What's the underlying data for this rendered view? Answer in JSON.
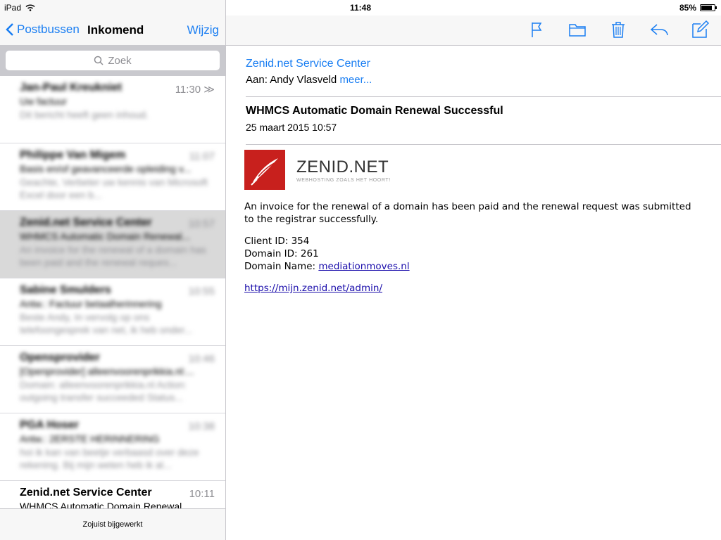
{
  "status": {
    "device": "iPad",
    "time": "11:48",
    "battery": "85%",
    "battery_level": 0.85
  },
  "nav": {
    "back_label": "Postbussen",
    "title": "Inkomend",
    "edit_label": "Wijzig"
  },
  "search": {
    "placeholder": "Zoek"
  },
  "mail_list": [
    {
      "sender": "Jan-Paul Kreukniet",
      "time": "11:30",
      "subject": "Uw factuur",
      "preview": "Dit bericht heeft geen inhoud."
    },
    {
      "sender": "Philippe Van Migem",
      "time": "11:07",
      "subject": "Basis en/of geavanceerde opleiding v...",
      "preview": "Geachte, Verbeter uw kennis van Microsoft Excel door een b..."
    },
    {
      "sender": "Zenid.net Service Center",
      "time": "10:57",
      "subject": "WHMCS Automatic Domain Renewal...",
      "preview": "An invoice for the renewal of a domain has been paid and the renewal reques..."
    },
    {
      "sender": "Sabine Smulders",
      "time": "10:55",
      "subject": "Antw.: Factuur betaalherinnering",
      "preview": "Beste Andy, In vervolg op ons telefoongesprek van net, ik heb onder..."
    },
    {
      "sender": "Opensprovider",
      "time": "10:46",
      "subject": "[Openprovider] alleenvoorenprikkia.nl:...",
      "preview": "Domain: alleenvoorenprikkia.nl Action: outgoing transfer succeeded Status..."
    },
    {
      "sender": "PGA Hoser",
      "time": "10:38",
      "subject": "Antw.: 2ERSTE HERINNERING",
      "preview": "hoi ik kan van beetje verbaasd over deze rekening. Bij mijn weten heb ik al..."
    },
    {
      "sender": "Zenid.net Service Center",
      "time": "10:11",
      "subject": "WHMCS Automatic Domain Renewal...",
      "preview": ""
    }
  ],
  "footer_status": "Zojuist bijgewerkt",
  "message": {
    "from": "Zenid.net Service Center",
    "to_prefix": "Aan:",
    "to_name": "Andy Vlasveld",
    "more": "meer...",
    "subject": "WHMCS Automatic Domain Renewal Successful",
    "date": "25 maart 2015 10:57",
    "logo_name": "ZENID.NET",
    "logo_tagline": "WEBHOSTING ZOALS HET HOORT!",
    "intro": "An invoice for the renewal of a domain has been paid and the renewal request was submitted to the registrar successfully.",
    "client_id_label": "Client ID: 354",
    "domain_id_label": "Domain ID: 261",
    "domain_name_label": "Domain Name:",
    "domain_name": "mediationmoves.nl",
    "admin_link": "https://mijn.zenid.net/admin/"
  },
  "colors": {
    "accent": "#1a7ef2",
    "brand": "#c8201d"
  },
  "icons": [
    "flag-icon",
    "folder-icon",
    "trash-icon",
    "reply-icon",
    "compose-icon"
  ]
}
